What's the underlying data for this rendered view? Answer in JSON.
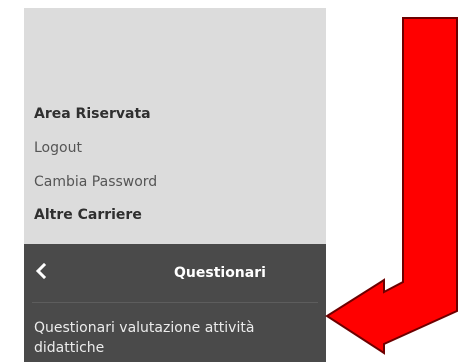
{
  "menu": {
    "reserved_area_heading": "Area Riservata",
    "logout_label": "Logout",
    "change_password_label": "Cambia Password",
    "other_careers_label": "Altre Carriere"
  },
  "submenu": {
    "back_icon": "chevron-left-icon",
    "title": "Questionari",
    "item_label": "Questionari valutazione attività didattiche"
  },
  "annotation": {
    "arrow_color": "#ff0000",
    "arrow_outline": "#6d0000"
  }
}
